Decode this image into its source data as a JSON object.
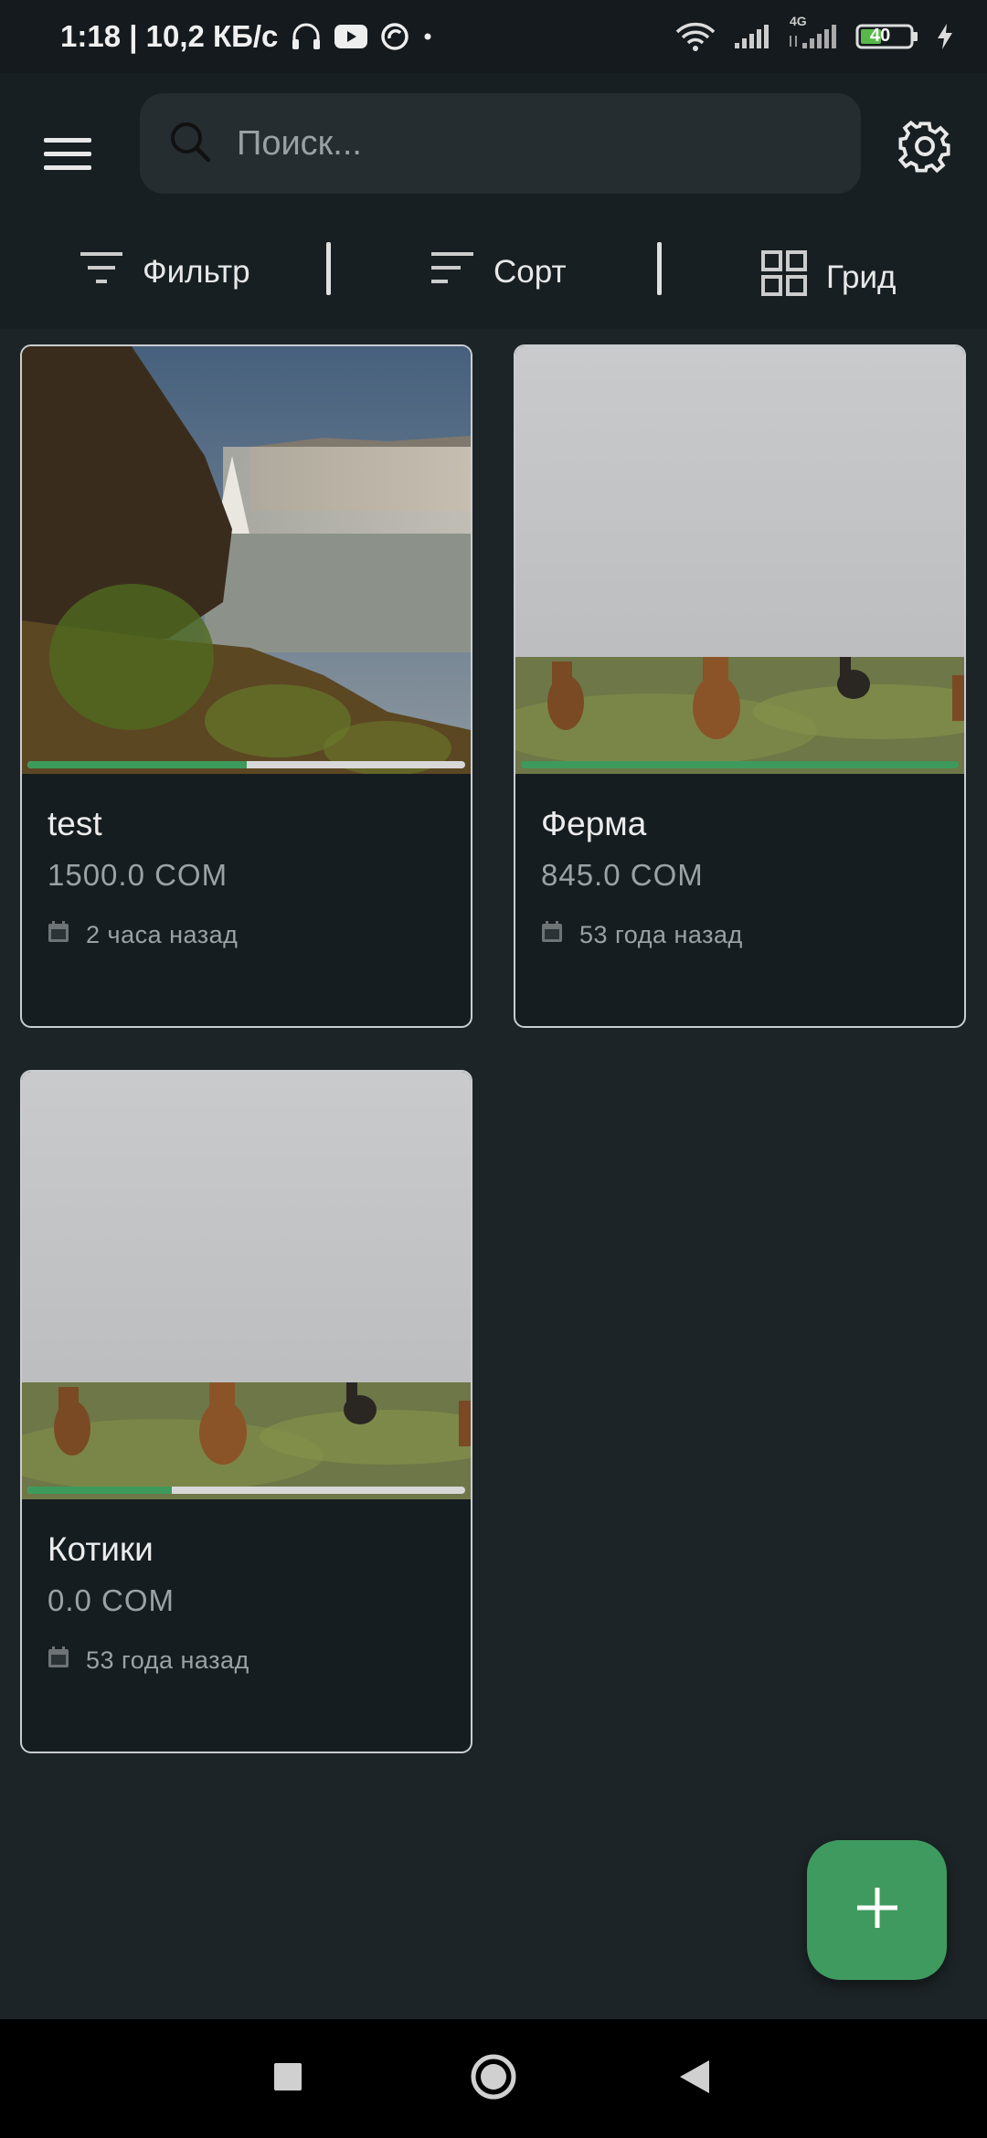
{
  "status_bar": {
    "time_info": "1:18 | 10,2 КБ/с",
    "network_label": "4G",
    "battery_level": "40"
  },
  "search": {
    "placeholder": "Поиск..."
  },
  "toolbar": {
    "filter_label": "Фильтр",
    "sort_label": "Сорт",
    "view_label": "Грид"
  },
  "cards": [
    {
      "title": "test",
      "price": "1500.0 COM",
      "date": "2 часа назад",
      "image": "waterfall",
      "progress": 0.5
    },
    {
      "title": "Ферма",
      "price": "845.0 COM",
      "date": "53 года назад",
      "image": "horses",
      "progress": 1.0
    },
    {
      "title": "Котики",
      "price": "0.0 COM",
      "date": "53 года назад",
      "image": "horses",
      "progress": 0.33
    }
  ],
  "colors": {
    "accent": "#3f9a5f",
    "background": "#1d2427",
    "card_background": "#161d20"
  }
}
